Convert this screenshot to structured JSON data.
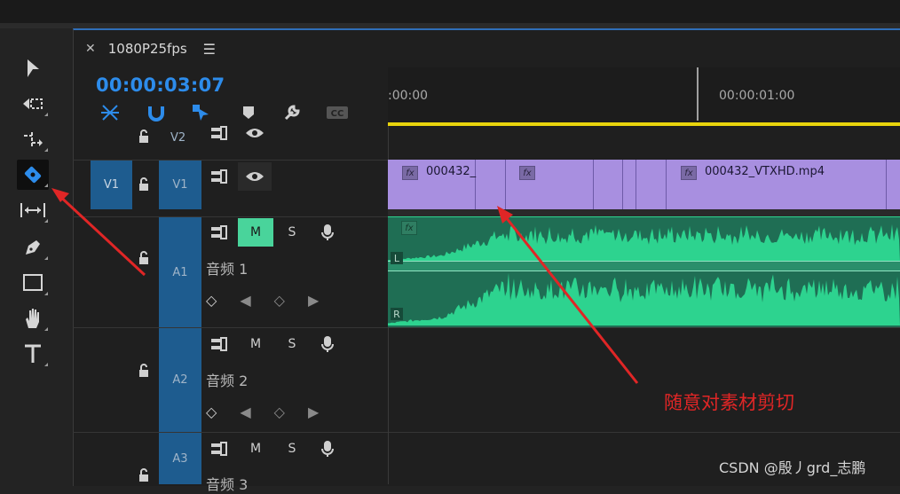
{
  "sequence": {
    "tab_title": "1080P25fps",
    "timecode": "00:00:03:07"
  },
  "ruler": {
    "start_label": ":00:00",
    "one_second_label": "00:00:01:00"
  },
  "tracks": {
    "v2": {
      "target": "",
      "name": "V2"
    },
    "v1": {
      "target": "V1",
      "name": "V1"
    },
    "a1": {
      "name": "A1",
      "label": "音频 1"
    },
    "a2": {
      "name": "A2",
      "label": "音频 2"
    },
    "a3": {
      "name": "A3",
      "label": "音频 3"
    }
  },
  "buttons": {
    "mute": "M",
    "solo": "S"
  },
  "clips": {
    "video_short": "000432_",
    "video_full": "000432_VTXHD.mp4",
    "fx": "fx",
    "channel_left": "L",
    "channel_right": "R"
  },
  "annotation": {
    "text": "随意对素材剪切",
    "color": "#e02626"
  },
  "watermark": "CSDN @殷丿grd_志鹏",
  "colors": {
    "accent": "#2d8ceb",
    "clip_video": "#a88fe0",
    "clip_audio": "#2dd38f",
    "track_header": "#1e5c8f"
  }
}
